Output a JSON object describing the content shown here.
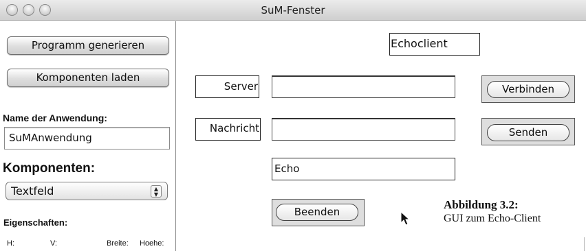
{
  "window": {
    "title": "SuM-Fenster"
  },
  "left": {
    "generate_button": "Programm generieren",
    "load_button": "Komponenten laden",
    "app_name_label": "Name der Anwendung:",
    "app_name_value": "SuMAnwendung",
    "components_label": "Komponenten:",
    "components_selected": "Textfeld",
    "properties_label": "Eigenschaften:",
    "props": {
      "h": "H:",
      "v": "V:",
      "width": "Breite:",
      "height": "Hoehe:"
    }
  },
  "right": {
    "title_box": "Echoclient",
    "server_label": "Server",
    "server_value": "",
    "message_label": "Nachricht",
    "message_value": "",
    "echo_value": "Echo",
    "connect_button": "Verbinden",
    "send_button": "Senden",
    "quit_button": "Beenden"
  },
  "caption": {
    "title": "Abbildung 3.2:",
    "subtitle": "GUI zum Echo-Client"
  },
  "icons": [
    "mouse-cursor-icon",
    "chevron-up-down-icon"
  ]
}
